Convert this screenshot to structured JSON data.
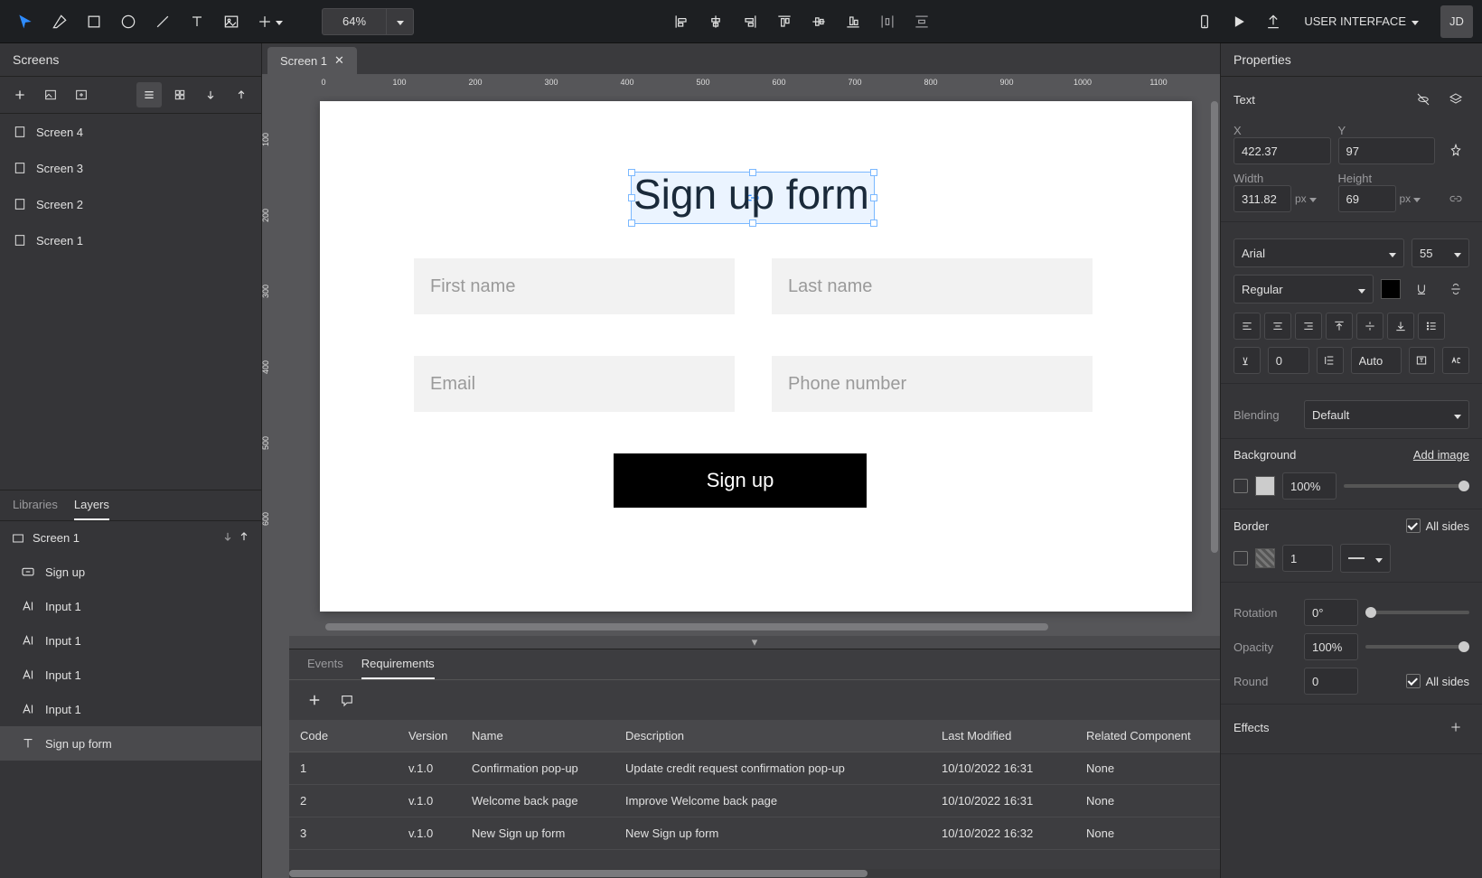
{
  "project_name": "USER INTERFACE",
  "user_initials": "JD",
  "zoom": "64%",
  "tabs": {
    "open": [
      {
        "label": "Screen 1"
      }
    ]
  },
  "screens": {
    "header": "Screens",
    "items": [
      {
        "label": "Screen 4"
      },
      {
        "label": "Screen 3"
      },
      {
        "label": "Screen 2"
      },
      {
        "label": "Screen 1"
      }
    ]
  },
  "layers_panel": {
    "tabs": {
      "libraries": "Libraries",
      "layers": "Layers"
    },
    "root": "Screen 1",
    "items": [
      {
        "type": "group",
        "label": "Sign up"
      },
      {
        "type": "text",
        "label": "Input 1"
      },
      {
        "type": "text",
        "label": "Input 1"
      },
      {
        "type": "text",
        "label": "Input 1"
      },
      {
        "type": "text",
        "label": "Input 1"
      },
      {
        "type": "text",
        "label": "Sign up form",
        "selected": true
      }
    ]
  },
  "canvas": {
    "ruler_h": [
      "0",
      "100",
      "200",
      "300",
      "400",
      "500",
      "600",
      "700",
      "800",
      "900",
      "1000",
      "1100"
    ],
    "ruler_v": [
      "100",
      "200",
      "300",
      "400",
      "500",
      "600"
    ],
    "form": {
      "title": "Sign up form",
      "first_name": "First name",
      "last_name": "Last name",
      "email": "Email",
      "phone": "Phone number",
      "button": "Sign up"
    }
  },
  "bottom_panel": {
    "tabs": {
      "events": "Events",
      "requirements": "Requirements"
    },
    "columns": [
      "Code",
      "Version",
      "Name",
      "Description",
      "Last Modified",
      "Related Component"
    ],
    "rows": [
      {
        "code": "1",
        "version": "v.1.0",
        "name": "Confirmation pop-up",
        "desc": "Update credit request confirmation pop-up",
        "modified": "10/10/2022 16:31",
        "related": "None"
      },
      {
        "code": "2",
        "version": "v.1.0",
        "name": "Welcome back page",
        "desc": "Improve Welcome back page",
        "modified": "10/10/2022 16:31",
        "related": "None"
      },
      {
        "code": "3",
        "version": "v.1.0",
        "name": "New Sign up form",
        "desc": "New Sign up form",
        "modified": "10/10/2022 16:32",
        "related": "None"
      }
    ]
  },
  "properties": {
    "header": "Properties",
    "element_type": "Text",
    "position": {
      "x_label": "X",
      "y_label": "Y",
      "x": "422.37",
      "y": "97"
    },
    "size": {
      "w_label": "Width",
      "h_label": "Height",
      "w": "311.82",
      "h": "69",
      "unit": "px"
    },
    "font": {
      "family": "Arial",
      "size": "55",
      "weight": "Regular",
      "color": "#000000"
    },
    "letter_spacing": "0",
    "line_height": "Auto",
    "blending": {
      "label": "Blending",
      "value": "Default"
    },
    "background": {
      "label": "Background",
      "add_image": "Add image",
      "opacity": "100%",
      "color": "#cccccc"
    },
    "border": {
      "label": "Border",
      "all_sides": "All sides",
      "width": "1"
    },
    "rotation": {
      "label": "Rotation",
      "value": "0°"
    },
    "opacity": {
      "label": "Opacity",
      "value": "100%"
    },
    "round": {
      "label": "Round",
      "value": "0",
      "all_sides": "All sides"
    },
    "effects": {
      "label": "Effects"
    }
  }
}
